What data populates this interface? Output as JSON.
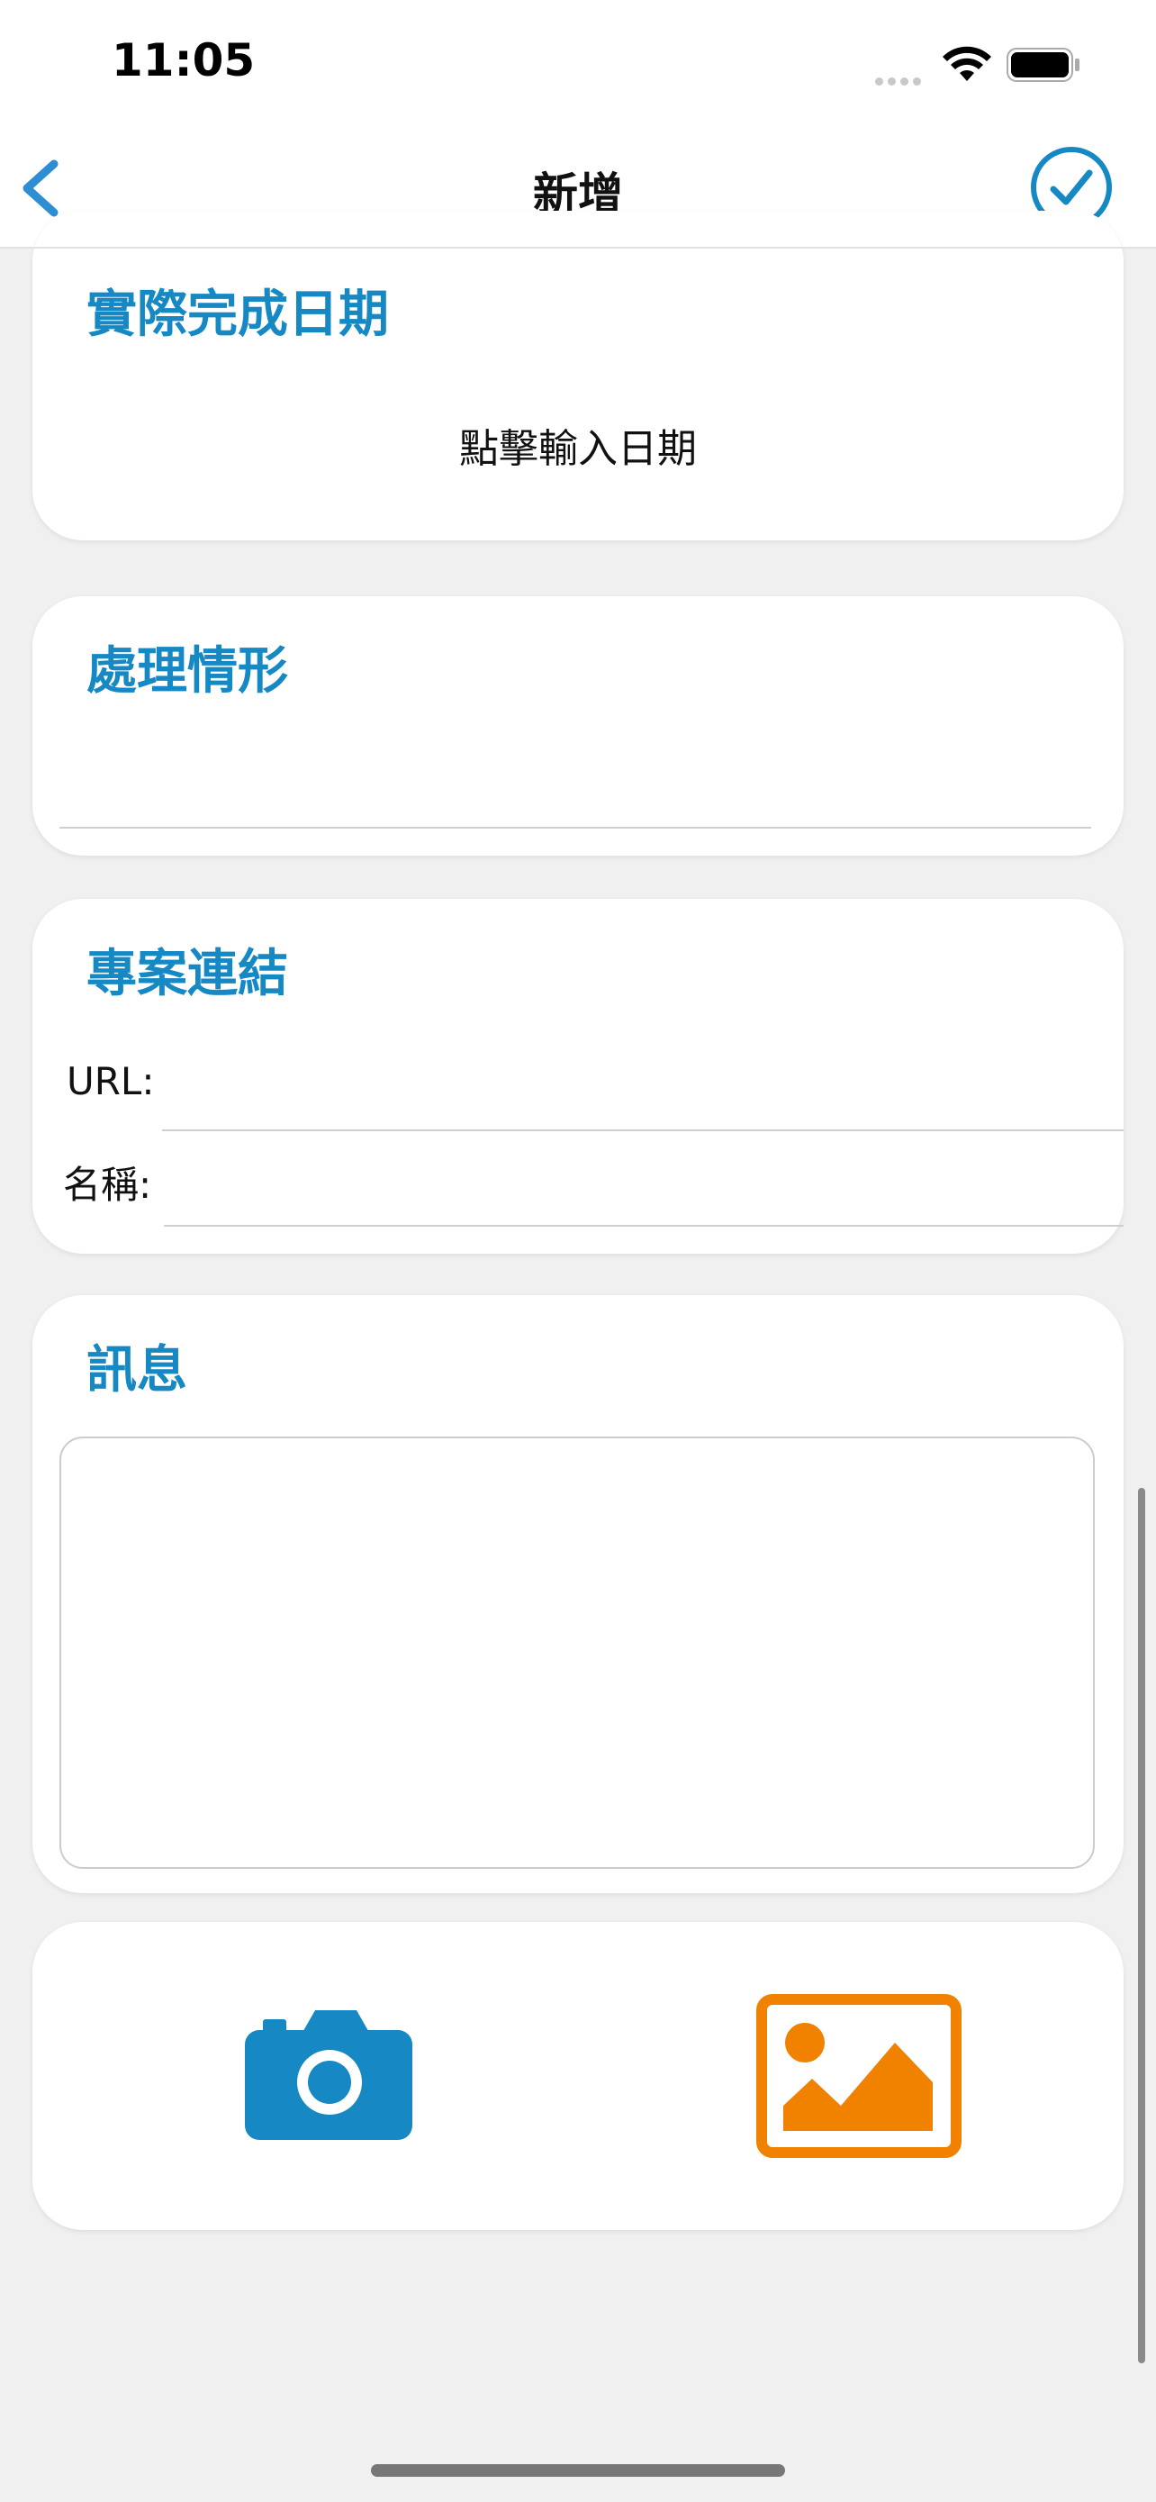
{
  "status_bar": {
    "time": "11:05"
  },
  "nav": {
    "title": "新增",
    "back_icon": "chevron-left-icon",
    "done_icon": "checkmark-circle-icon",
    "accent": "#2d8ed4"
  },
  "completion_date": {
    "title": "實際完成日期",
    "value": "點擊輸入日期"
  },
  "status_section": {
    "title": "處理情形",
    "value": ""
  },
  "project_link": {
    "title": "專案連結",
    "url_label": "URL:",
    "url_value": "",
    "name_label": "名稱:",
    "name_value": ""
  },
  "message": {
    "title": "訊息",
    "value": ""
  },
  "media": {
    "camera_icon": "camera-icon",
    "camera_color": "#1688c4",
    "gallery_icon": "image-icon",
    "gallery_color": "#f08200"
  }
}
